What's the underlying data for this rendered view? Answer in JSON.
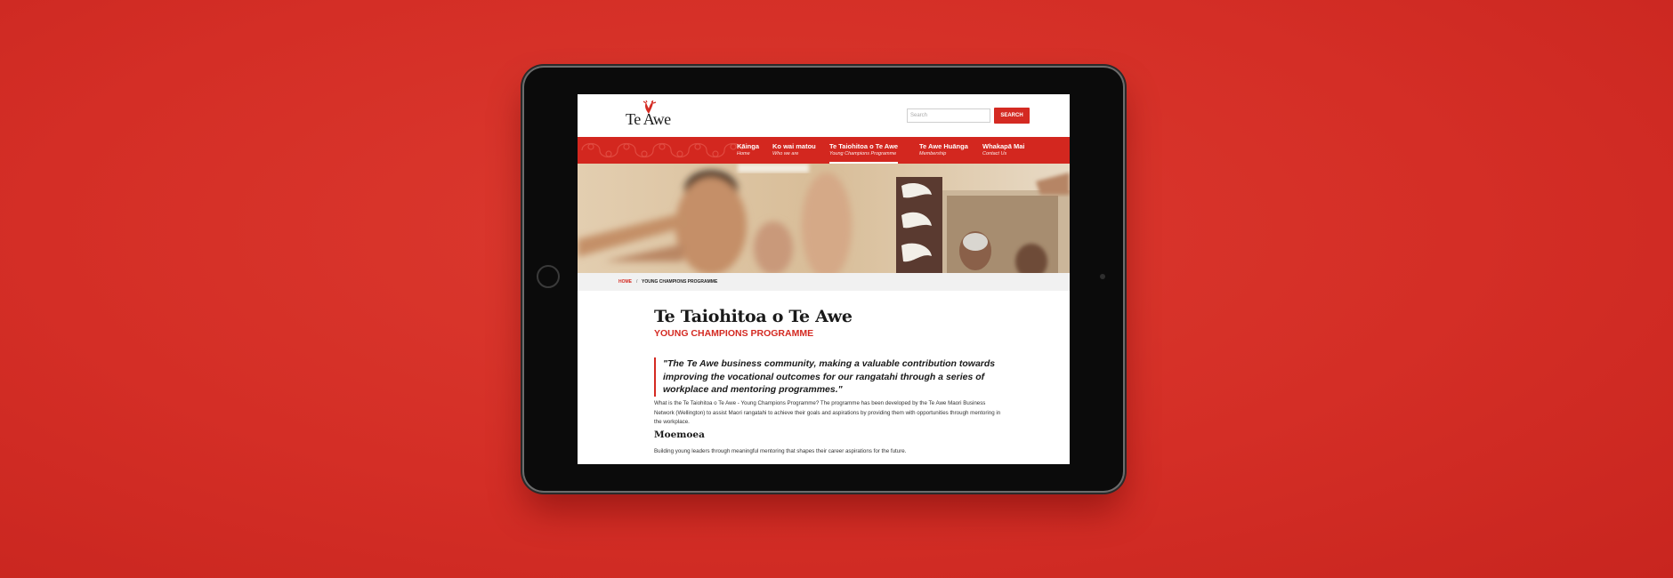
{
  "colors": {
    "background": "#d42e26",
    "brand_red": "#d42a22",
    "nav_red": "#d3271f",
    "tablet_bezel": "#0b0b0b"
  },
  "header": {
    "logo_text": "Te Awe",
    "search_placeholder": "Search",
    "search_button": "SEARCH"
  },
  "nav": {
    "items": [
      {
        "label": "Kāinga",
        "sub": "Home"
      },
      {
        "label": "Ko wai matou",
        "sub": "Who we are"
      },
      {
        "label": "Te Taiohitoa o Te Awe",
        "sub": "Young Champions Programme",
        "active": true
      },
      {
        "label": "Te Awe Huānga",
        "sub": "Membership"
      },
      {
        "label": "Whakapā Mai",
        "sub": "Contact Us"
      }
    ]
  },
  "breadcrumb": {
    "home": "HOME",
    "separator": "/",
    "current": "YOUNG CHAMPIONS PROGRAMME"
  },
  "main": {
    "title": "Te Taiohitoa o Te Awe",
    "subtitle": "YOUNG CHAMPIONS PROGRAMME",
    "quote": "\"The Te Awe business community, making a valuable contribution towards improving the vocational outcomes for our rangatahi through a series of workplace and mentoring programmes.\"",
    "intro": "What is the Te Taiohitoa o Te Awe - Young Champions Programme? The programme has been developed by the Te Awe Maori Business Network (Wellington) to assist Maori rangatahi to achieve their goals and aspirations by providing them with opportunities through mentoring in the workplace.",
    "section_heading": "Moemoea",
    "section_text": "Building young leaders through meaningful mentoring that shapes their career aspirations for the future."
  }
}
